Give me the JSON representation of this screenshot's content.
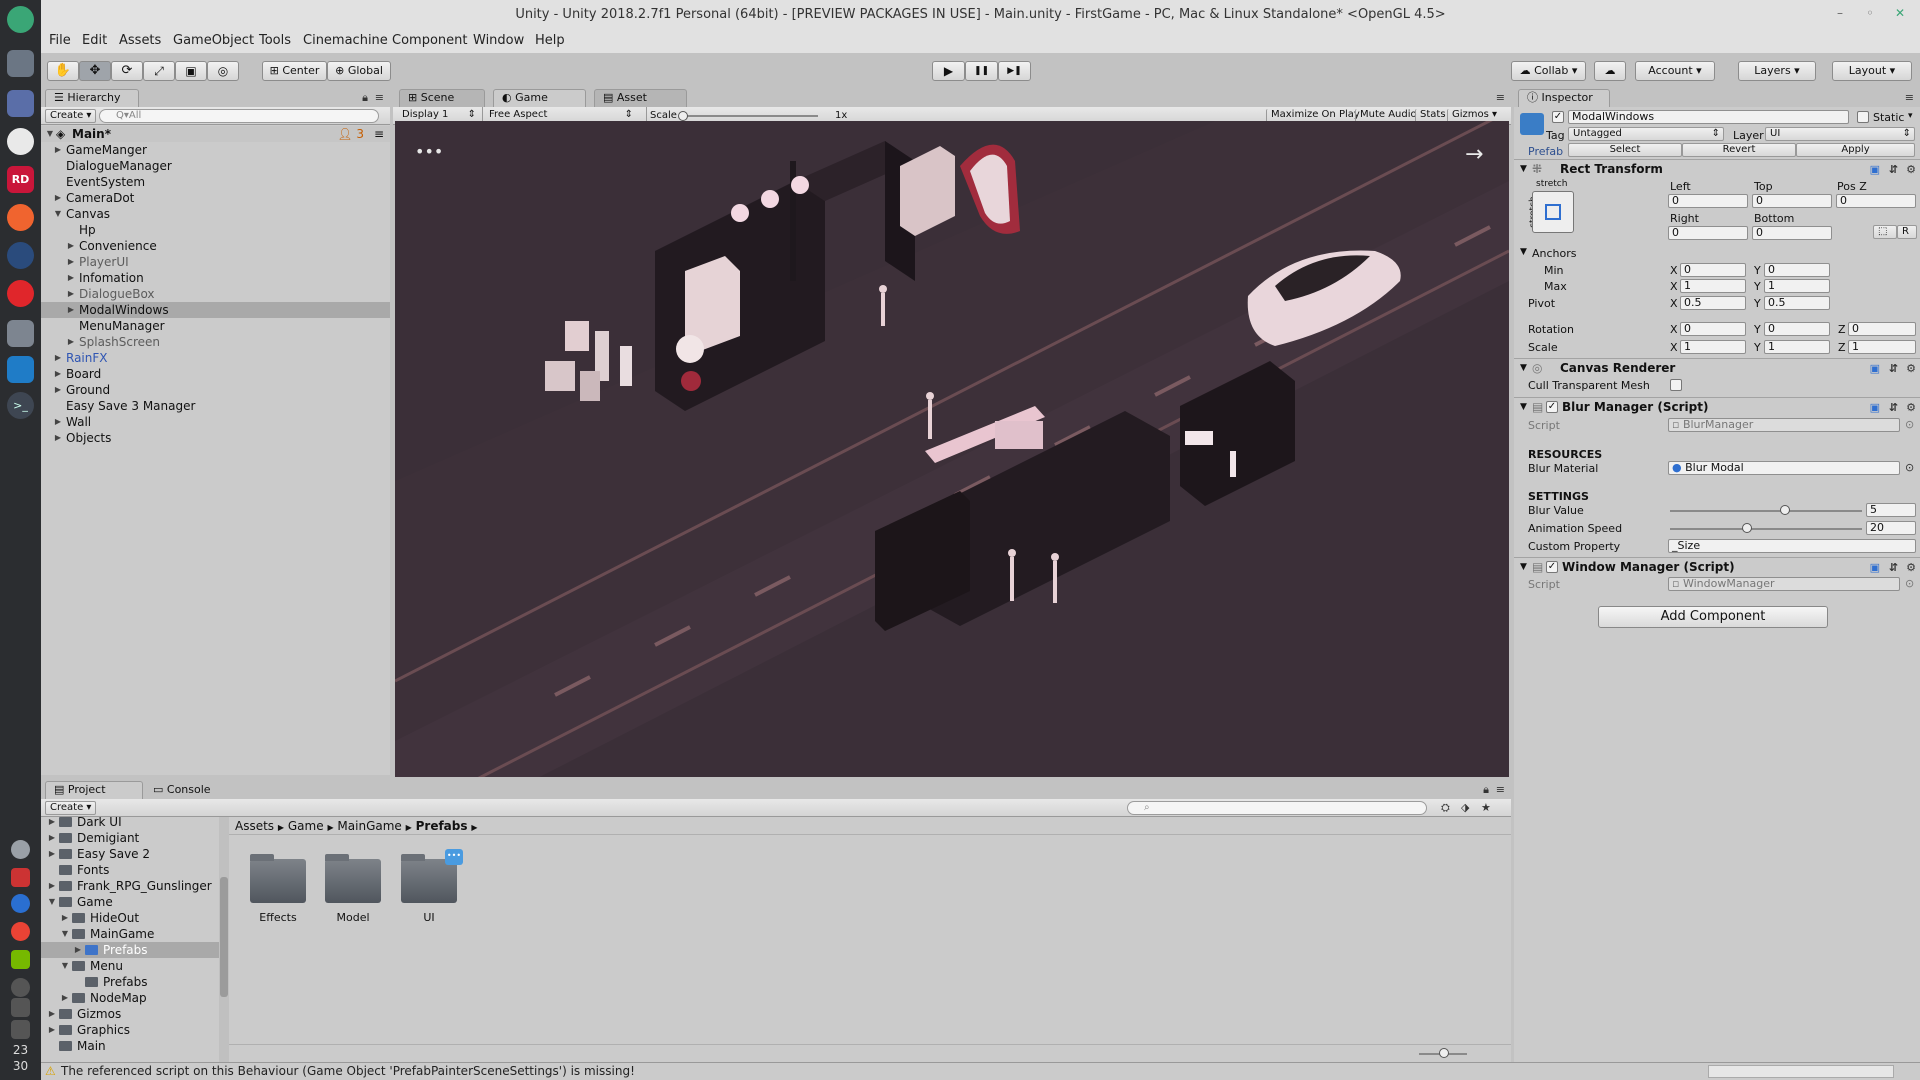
{
  "window": {
    "title": "Unity - Unity 2018.2.7f1 Personal (64bit) - [PREVIEW PACKAGES IN USE] - Main.unity - FirstGame - PC, Mac & Linux Standalone* <OpenGL 4.5>",
    "min": "–",
    "restore": "◦",
    "close": "✕"
  },
  "menu": [
    "File",
    "Edit",
    "Assets",
    "GameObject",
    "Tools",
    "Cinemachine",
    "Component",
    "Window",
    "Help"
  ],
  "toolbar": {
    "center": "Center",
    "global": "Global",
    "collab": "Collab",
    "account": "Account",
    "layers": "Layers",
    "layout": "Layout",
    "play": "▶",
    "pause": "❚❚",
    "step": "▶❚"
  },
  "hierarchy": {
    "tab": "Hierarchy",
    "create": "Create",
    "search_placeholder": "Q▾All",
    "scene": "Main*",
    "badge": "3",
    "items": [
      {
        "label": "GameManger",
        "arrow": "▶"
      },
      {
        "label": "DialogueManager",
        "arrow": ""
      },
      {
        "label": "EventSystem",
        "arrow": ""
      },
      {
        "label": "CameraDot",
        "arrow": "▶"
      },
      {
        "label": "Canvas",
        "arrow": "▼"
      },
      {
        "label": "Hp",
        "arrow": ""
      },
      {
        "label": "Convenience",
        "arrow": "▶"
      },
      {
        "label": "PlayerUI",
        "arrow": "▶"
      },
      {
        "label": "Infomation",
        "arrow": "▶"
      },
      {
        "label": "DialogueBox",
        "arrow": "▶"
      },
      {
        "label": "ModalWindows",
        "arrow": "▶"
      },
      {
        "label": "MenuManager",
        "arrow": ""
      },
      {
        "label": "SplashScreen",
        "arrow": "▶"
      },
      {
        "label": "RainFX",
        "arrow": "▶"
      },
      {
        "label": "Board",
        "arrow": "▶"
      },
      {
        "label": "Ground",
        "arrow": "▶"
      },
      {
        "label": "Easy Save 3 Manager",
        "arrow": ""
      },
      {
        "label": "Wall",
        "arrow": "▶"
      },
      {
        "label": "Objects",
        "arrow": "▶"
      }
    ]
  },
  "gameview": {
    "tab_scene": "Scene",
    "tab_game": "Game",
    "tab_store": "Asset Store",
    "display": "Display 1",
    "aspect": "Free Aspect",
    "scale_label": "Scale",
    "scale_value": "1x",
    "maximize": "Maximize On Play",
    "mute": "Mute Audio",
    "stats": "Stats",
    "gizmos": "Gizmos",
    "menu_dots": "•••",
    "arrow": "→"
  },
  "inspector": {
    "tab": "Inspector",
    "object_name": "ModalWindows",
    "static": "Static",
    "tag_label": "Tag",
    "tag": "Untagged",
    "layer_label": "Layer",
    "layer": "UI",
    "prefab": "Prefab",
    "select": "Select",
    "revert": "Revert",
    "apply": "Apply",
    "rect": {
      "title": "Rect Transform",
      "stretch": "stretch",
      "stretch_v": "stretch",
      "left_label": "Left",
      "top_label": "Top",
      "posz_label": "Pos Z",
      "left": "0",
      "top": "0",
      "posz": "0",
      "right_label": "Right",
      "bottom_label": "Bottom",
      "right": "0",
      "bottom": "0",
      "r_btn": "R",
      "anchors": "Anchors",
      "min": "Min",
      "max": "Max",
      "min_x": "0",
      "min_y": "0",
      "max_x": "1",
      "max_y": "1",
      "pivot": "Pivot",
      "pivot_x": "0.5",
      "pivot_y": "0.5",
      "rotation": "Rotation",
      "rot_x": "0",
      "rot_y": "0",
      "rot_z": "0",
      "scale": "Scale",
      "sc_x": "1",
      "sc_y": "1",
      "sc_z": "1",
      "x": "X",
      "y": "Y",
      "z": "Z"
    },
    "canvas_renderer": {
      "title": "Canvas Renderer",
      "cull": "Cull Transparent Mesh"
    },
    "blur": {
      "title": "Blur Manager (Script)",
      "script_label": "Script",
      "script": "BlurManager",
      "resources": "RESOURCES",
      "material_label": "Blur Material",
      "material": "Blur Modal",
      "settings": "SETTINGS",
      "blur_label": "Blur Value",
      "blur_value": "5",
      "blur_fraction": 0.6,
      "anim_label": "Animation Speed",
      "anim_value": "20",
      "anim_fraction": 0.4,
      "custom_label": "Custom Property",
      "custom": "_Size"
    },
    "window": {
      "title": "Window Manager (Script)",
      "script_label": "Script",
      "script": "WindowManager"
    },
    "add_component": "Add Component"
  },
  "project": {
    "tab": "Project",
    "console": "Console",
    "create": "Create",
    "tree": [
      {
        "label": "Dark UI",
        "arrow": "▶",
        "depth": 1
      },
      {
        "label": "Demigiant",
        "arrow": "▶",
        "depth": 1
      },
      {
        "label": "Easy Save 2",
        "arrow": "▶",
        "depth": 1
      },
      {
        "label": "Fonts",
        "arrow": "",
        "depth": 1
      },
      {
        "label": "Frank_RPG_Gunslinger",
        "arrow": "▶",
        "depth": 1
      },
      {
        "label": "Game",
        "arrow": "▼",
        "depth": 1
      },
      {
        "label": "HideOut",
        "arrow": "▶",
        "depth": 2
      },
      {
        "label": "MainGame",
        "arrow": "▼",
        "depth": 2
      },
      {
        "label": "Prefabs",
        "arrow": "▶",
        "depth": 3
      },
      {
        "label": "Menu",
        "arrow": "▼",
        "depth": 2
      },
      {
        "label": "Prefabs",
        "arrow": "",
        "depth": 3
      },
      {
        "label": "NodeMap",
        "arrow": "▶",
        "depth": 2
      },
      {
        "label": "Gizmos",
        "arrow": "▶",
        "depth": 1
      },
      {
        "label": "Graphics",
        "arrow": "▶",
        "depth": 1
      },
      {
        "label": "Main",
        "arrow": "",
        "depth": 1
      }
    ],
    "breadcrumb": [
      "Assets",
      "Game",
      "MainGame",
      "Prefabs"
    ],
    "folders": [
      "Effects",
      "Model",
      "UI"
    ]
  },
  "status": {
    "message": "The referenced script on this Behaviour (Game Object 'PrefabPainterSceneSettings') is missing!"
  },
  "clock": {
    "h": "23",
    "m": "30"
  }
}
